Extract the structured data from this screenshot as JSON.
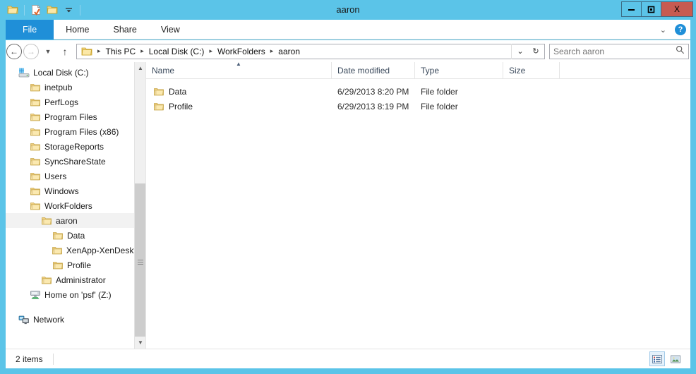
{
  "window": {
    "title": "aaron",
    "controls": {
      "minimize": "—",
      "maximize": "❐",
      "close": "X"
    },
    "quick_access": [
      "folder-icon",
      "properties-icon",
      "new-folder-icon",
      "customize-dropdown-icon"
    ]
  },
  "ribbon": {
    "tabs": [
      {
        "label": "File",
        "active": true
      },
      {
        "label": "Home",
        "active": false
      },
      {
        "label": "Share",
        "active": false
      },
      {
        "label": "View",
        "active": false
      }
    ],
    "expand_label": "⌄",
    "help_label": "?"
  },
  "address": {
    "back_label": "←",
    "forward_label": "→",
    "recent_label": "⌄",
    "up_label": "↑",
    "breadcrumbs": [
      "This PC",
      "Local Disk (C:)",
      "WorkFolders",
      "aaron"
    ],
    "separator": "▸",
    "dropdown_label": "⌄",
    "refresh_label": "↻"
  },
  "search": {
    "placeholder": "Search aaron",
    "value": "",
    "icon": "search-icon"
  },
  "navigation_pane": {
    "items": [
      {
        "label": "Local Disk (C:)",
        "icon": "drive-icon",
        "indent": 0,
        "selected": false
      },
      {
        "label": "inetpub",
        "icon": "folder-icon",
        "indent": 1,
        "selected": false
      },
      {
        "label": "PerfLogs",
        "icon": "folder-icon",
        "indent": 1,
        "selected": false
      },
      {
        "label": "Program Files",
        "icon": "folder-icon",
        "indent": 1,
        "selected": false
      },
      {
        "label": "Program Files (x86)",
        "icon": "folder-icon",
        "indent": 1,
        "selected": false
      },
      {
        "label": "StorageReports",
        "icon": "folder-icon",
        "indent": 1,
        "selected": false
      },
      {
        "label": "SyncShareState",
        "icon": "folder-icon",
        "indent": 1,
        "selected": false
      },
      {
        "label": "Users",
        "icon": "folder-icon",
        "indent": 1,
        "selected": false
      },
      {
        "label": "Windows",
        "icon": "folder-icon",
        "indent": 1,
        "selected": false
      },
      {
        "label": "WorkFolders",
        "icon": "folder-icon",
        "indent": 1,
        "selected": false
      },
      {
        "label": "aaron",
        "icon": "folder-icon",
        "indent": 2,
        "selected": true
      },
      {
        "label": "Data",
        "icon": "folder-icon",
        "indent": 3,
        "selected": false
      },
      {
        "label": "XenApp-XenDesktop",
        "icon": "folder-icon",
        "indent": 4,
        "selected": false
      },
      {
        "label": "Profile",
        "icon": "folder-icon",
        "indent": 3,
        "selected": false
      },
      {
        "label": "Administrator",
        "icon": "folder-icon",
        "indent": 2,
        "selected": false
      },
      {
        "label": "Home on 'psf' (Z:)",
        "icon": "network-drive-icon",
        "indent": 1,
        "selected": false
      },
      {
        "label": "",
        "icon": "spacer",
        "indent": 0,
        "selected": false
      },
      {
        "label": "Network",
        "icon": "network-icon",
        "indent": 0,
        "selected": false
      }
    ]
  },
  "file_list": {
    "columns": [
      {
        "label": "Name",
        "sorted": true,
        "sort_direction": "asc"
      },
      {
        "label": "Date modified",
        "sorted": false
      },
      {
        "label": "Type",
        "sorted": false
      },
      {
        "label": "Size",
        "sorted": false
      }
    ],
    "sort_indicator": "▲",
    "rows": [
      {
        "name": "Data",
        "date_modified": "6/29/2013 8:20 PM",
        "type": "File folder",
        "size": "",
        "icon": "folder-icon"
      },
      {
        "name": "Profile",
        "date_modified": "6/29/2013 8:19 PM",
        "type": "File folder",
        "size": "",
        "icon": "folder-icon"
      }
    ]
  },
  "status_bar": {
    "item_count": "2 items",
    "view_buttons": [
      {
        "name": "details-view",
        "active": true
      },
      {
        "name": "large-icons-view",
        "active": false
      }
    ]
  },
  "colors": {
    "title_bar": "#5bc4e8",
    "file_tab": "#1f8fd8",
    "close_button": "#c75b51",
    "selection": "#f2f2f2",
    "column_header_text": "#3b4a5c"
  }
}
